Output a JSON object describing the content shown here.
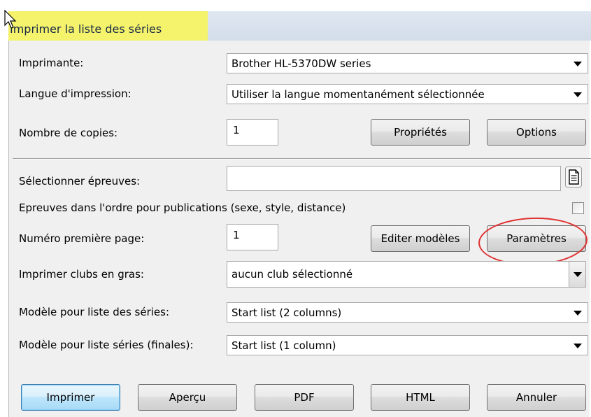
{
  "dialog": {
    "title": "Imprimer la liste des séries"
  },
  "fields": {
    "printer_label": "Imprimante:",
    "printer_value": "Brother HL-5370DW series",
    "language_label": "Langue d'impression:",
    "language_value": "Utiliser la langue momentanément sélectionnée",
    "copies_label": "Nombre de copies:",
    "copies_value": "1",
    "select_heats_label": "Sélectionner épreuves:",
    "select_heats_value": "",
    "events_order_label": "Epreuves dans l'ordre pour publications (sexe, style, distance)",
    "events_order_checked": false,
    "first_page_label": "Numéro première page:",
    "first_page_value": "1",
    "bold_clubs_label": "Imprimer clubs en gras:",
    "bold_clubs_value": "aucun club sélectionné",
    "template_label": "Modèle pour liste des séries:",
    "template_value": "Start list (2 columns)",
    "template_finals_label": "Modèle pour liste séries (finales):",
    "template_finals_value": "Start list (1 column)"
  },
  "buttons": {
    "properties": "Propriétés",
    "options": "Options",
    "edit_templates": "Editer modèles",
    "parameters": "Paramètres",
    "print": "Imprimer",
    "preview": "Aperçu",
    "pdf": "PDF",
    "html": "HTML",
    "cancel": "Annuler"
  },
  "icons": {
    "cursor": "mouse-pointer-icon",
    "select_heats": "document-icon",
    "dropdown": "chevron-down-icon"
  },
  "colors": {
    "title_highlight": "#f4f36b",
    "annotation_circle": "#e03030",
    "default_button": "#bee6fd"
  }
}
